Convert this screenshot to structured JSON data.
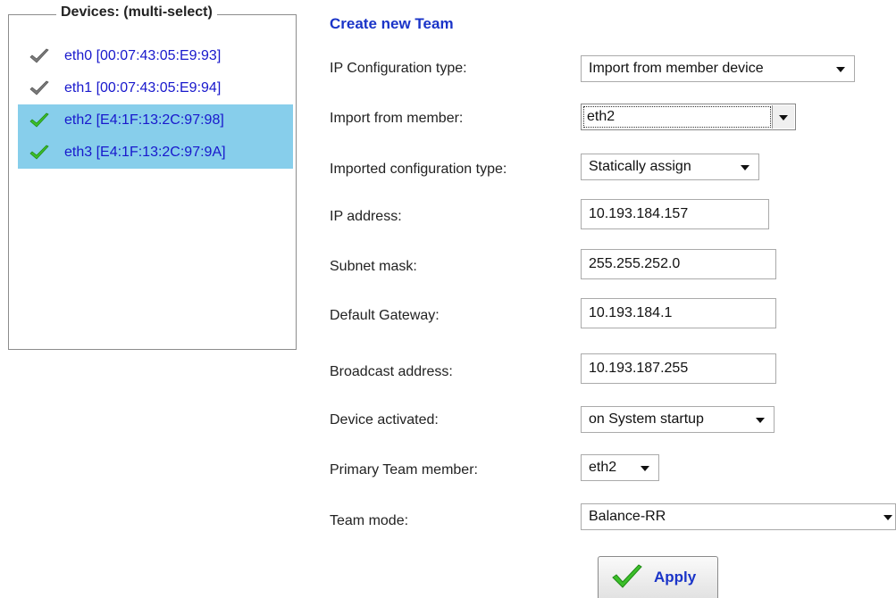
{
  "devices": {
    "legend": "Devices: (multi-select)",
    "items": [
      {
        "label": "eth0 [00:07:43:05:E9:93]",
        "selected": false
      },
      {
        "label": "eth1 [00:07:43:05:E9:94]",
        "selected": false
      },
      {
        "label": "eth2 [E4:1F:13:2C:97:98]",
        "selected": true
      },
      {
        "label": "eth3 [E4:1F:13:2C:97:9A]",
        "selected": true
      }
    ]
  },
  "form": {
    "title": "Create new Team",
    "ip_config_type": {
      "label": "IP Configuration type:",
      "value": "Import from member device"
    },
    "import_from_member": {
      "label": "Import from member:",
      "value": "eth2"
    },
    "imported_config_type": {
      "label": "Imported configuration type:",
      "value": "Statically assign"
    },
    "ip_address": {
      "label": "IP address:",
      "value": "10.193.184.157"
    },
    "subnet_mask": {
      "label": "Subnet mask:",
      "value": "255.255.252.0"
    },
    "default_gateway": {
      "label": "Default Gateway:",
      "value": "10.193.184.1"
    },
    "broadcast_address": {
      "label": "Broadcast address:",
      "value": "10.193.187.255"
    },
    "device_activated": {
      "label": "Device activated:",
      "value": "on System startup"
    },
    "primary_team_member": {
      "label": "Primary Team member:",
      "value": "eth2"
    },
    "team_mode": {
      "label": "Team mode:",
      "value": "Balance-RR"
    },
    "apply_label": "Apply"
  },
  "colors": {
    "selection": "#87ceeb",
    "link_blue": "#1818cc",
    "title_blue": "#1a34c8",
    "check_gray": "#7a7a7a",
    "check_green": "#3cbf2a"
  },
  "icons": {
    "unselected_device": "gray-check-icon",
    "selected_device": "green-check-icon",
    "apply": "green-check-icon"
  }
}
